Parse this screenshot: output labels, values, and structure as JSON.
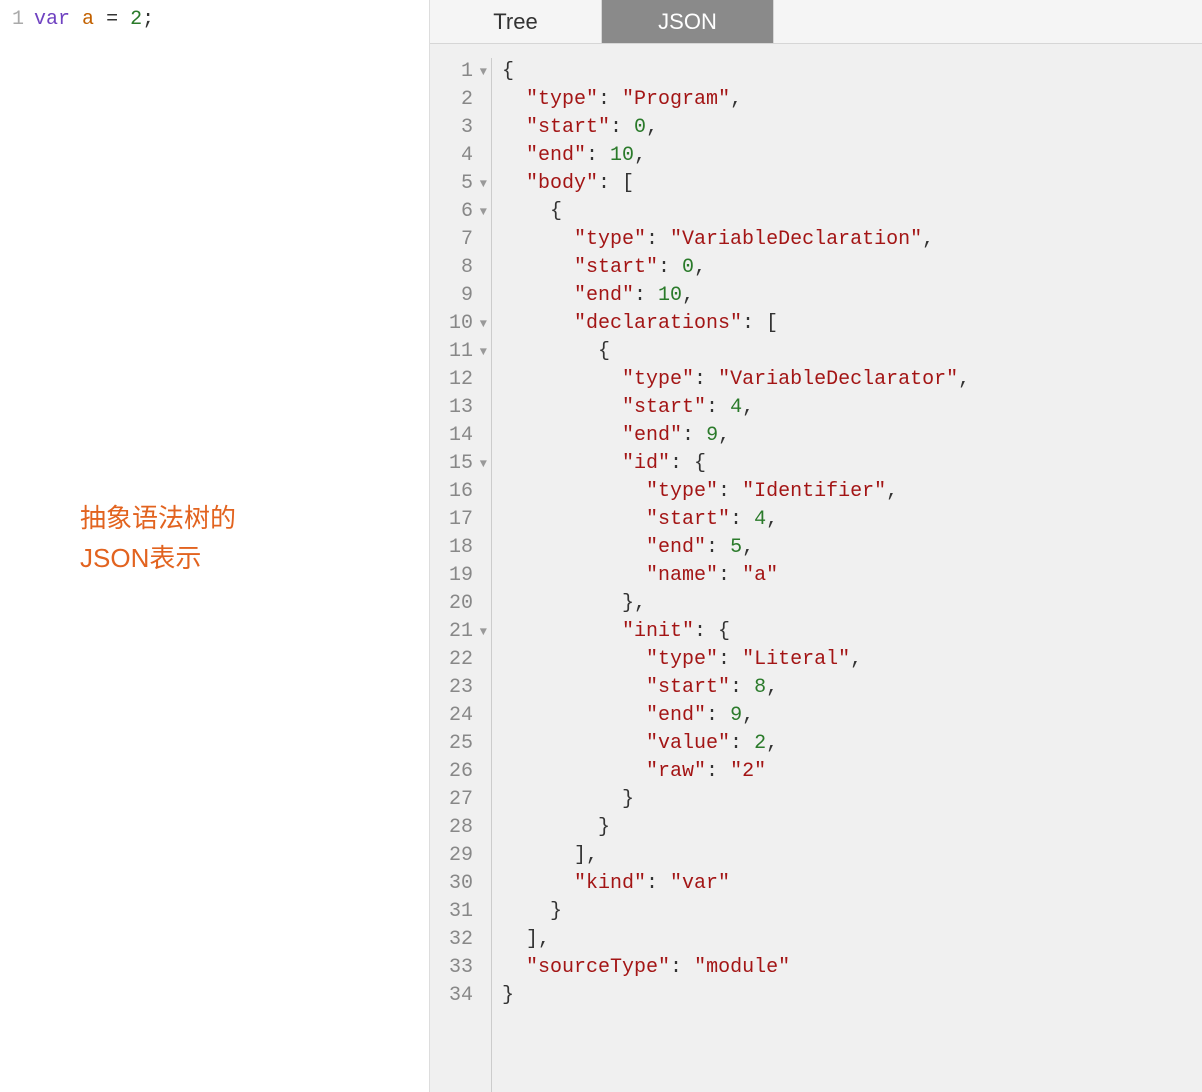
{
  "left": {
    "line_number": "1",
    "tokens": {
      "var": "var",
      "a": "a",
      "eq": "=",
      "two": "2",
      "semi": ";"
    },
    "annotation_l1": "抽象语法树的",
    "annotation_l2": "JSON表示"
  },
  "tabs": {
    "tree": "Tree",
    "json": "JSON"
  },
  "json": {
    "gutter": [
      "1",
      "2",
      "3",
      "4",
      "5",
      "6",
      "7",
      "8",
      "9",
      "10",
      "11",
      "12",
      "13",
      "14",
      "15",
      "16",
      "17",
      "18",
      "19",
      "20",
      "21",
      "22",
      "23",
      "24",
      "25",
      "26",
      "27",
      "28",
      "29",
      "30",
      "31",
      "32",
      "33",
      "34"
    ],
    "foldable": [
      1,
      5,
      6,
      10,
      11,
      15,
      21
    ],
    "lines": [
      [
        {
          "t": "p",
          "v": "{"
        }
      ],
      [
        {
          "t": "pad",
          "v": "  "
        },
        {
          "t": "k",
          "v": "\"type\""
        },
        {
          "t": "p",
          "v": ": "
        },
        {
          "t": "s",
          "v": "\"Program\""
        },
        {
          "t": "p",
          "v": ","
        }
      ],
      [
        {
          "t": "pad",
          "v": "  "
        },
        {
          "t": "k",
          "v": "\"start\""
        },
        {
          "t": "p",
          "v": ": "
        },
        {
          "t": "n",
          "v": "0"
        },
        {
          "t": "p",
          "v": ","
        }
      ],
      [
        {
          "t": "pad",
          "v": "  "
        },
        {
          "t": "k",
          "v": "\"end\""
        },
        {
          "t": "p",
          "v": ": "
        },
        {
          "t": "n",
          "v": "10"
        },
        {
          "t": "p",
          "v": ","
        }
      ],
      [
        {
          "t": "pad",
          "v": "  "
        },
        {
          "t": "k",
          "v": "\"body\""
        },
        {
          "t": "p",
          "v": ": ["
        }
      ],
      [
        {
          "t": "pad",
          "v": "    "
        },
        {
          "t": "p",
          "v": "{"
        }
      ],
      [
        {
          "t": "pad",
          "v": "      "
        },
        {
          "t": "k",
          "v": "\"type\""
        },
        {
          "t": "p",
          "v": ": "
        },
        {
          "t": "s",
          "v": "\"VariableDeclaration\""
        },
        {
          "t": "p",
          "v": ","
        }
      ],
      [
        {
          "t": "pad",
          "v": "      "
        },
        {
          "t": "k",
          "v": "\"start\""
        },
        {
          "t": "p",
          "v": ": "
        },
        {
          "t": "n",
          "v": "0"
        },
        {
          "t": "p",
          "v": ","
        }
      ],
      [
        {
          "t": "pad",
          "v": "      "
        },
        {
          "t": "k",
          "v": "\"end\""
        },
        {
          "t": "p",
          "v": ": "
        },
        {
          "t": "n",
          "v": "10"
        },
        {
          "t": "p",
          "v": ","
        }
      ],
      [
        {
          "t": "pad",
          "v": "      "
        },
        {
          "t": "k",
          "v": "\"declarations\""
        },
        {
          "t": "p",
          "v": ": ["
        }
      ],
      [
        {
          "t": "pad",
          "v": "        "
        },
        {
          "t": "p",
          "v": "{"
        }
      ],
      [
        {
          "t": "pad",
          "v": "          "
        },
        {
          "t": "k",
          "v": "\"type\""
        },
        {
          "t": "p",
          "v": ": "
        },
        {
          "t": "s",
          "v": "\"VariableDeclarator\""
        },
        {
          "t": "p",
          "v": ","
        }
      ],
      [
        {
          "t": "pad",
          "v": "          "
        },
        {
          "t": "k",
          "v": "\"start\""
        },
        {
          "t": "p",
          "v": ": "
        },
        {
          "t": "n",
          "v": "4"
        },
        {
          "t": "p",
          "v": ","
        }
      ],
      [
        {
          "t": "pad",
          "v": "          "
        },
        {
          "t": "k",
          "v": "\"end\""
        },
        {
          "t": "p",
          "v": ": "
        },
        {
          "t": "n",
          "v": "9"
        },
        {
          "t": "p",
          "v": ","
        }
      ],
      [
        {
          "t": "pad",
          "v": "          "
        },
        {
          "t": "k",
          "v": "\"id\""
        },
        {
          "t": "p",
          "v": ": {"
        }
      ],
      [
        {
          "t": "pad",
          "v": "            "
        },
        {
          "t": "k",
          "v": "\"type\""
        },
        {
          "t": "p",
          "v": ": "
        },
        {
          "t": "s",
          "v": "\"Identifier\""
        },
        {
          "t": "p",
          "v": ","
        }
      ],
      [
        {
          "t": "pad",
          "v": "            "
        },
        {
          "t": "k",
          "v": "\"start\""
        },
        {
          "t": "p",
          "v": ": "
        },
        {
          "t": "n",
          "v": "4"
        },
        {
          "t": "p",
          "v": ","
        }
      ],
      [
        {
          "t": "pad",
          "v": "            "
        },
        {
          "t": "k",
          "v": "\"end\""
        },
        {
          "t": "p",
          "v": ": "
        },
        {
          "t": "n",
          "v": "5"
        },
        {
          "t": "p",
          "v": ","
        }
      ],
      [
        {
          "t": "pad",
          "v": "            "
        },
        {
          "t": "k",
          "v": "\"name\""
        },
        {
          "t": "p",
          "v": ": "
        },
        {
          "t": "s",
          "v": "\"a\""
        }
      ],
      [
        {
          "t": "pad",
          "v": "          "
        },
        {
          "t": "p",
          "v": "},"
        }
      ],
      [
        {
          "t": "pad",
          "v": "          "
        },
        {
          "t": "k",
          "v": "\"init\""
        },
        {
          "t": "p",
          "v": ": {"
        }
      ],
      [
        {
          "t": "pad",
          "v": "            "
        },
        {
          "t": "k",
          "v": "\"type\""
        },
        {
          "t": "p",
          "v": ": "
        },
        {
          "t": "s",
          "v": "\"Literal\""
        },
        {
          "t": "p",
          "v": ","
        }
      ],
      [
        {
          "t": "pad",
          "v": "            "
        },
        {
          "t": "k",
          "v": "\"start\""
        },
        {
          "t": "p",
          "v": ": "
        },
        {
          "t": "n",
          "v": "8"
        },
        {
          "t": "p",
          "v": ","
        }
      ],
      [
        {
          "t": "pad",
          "v": "            "
        },
        {
          "t": "k",
          "v": "\"end\""
        },
        {
          "t": "p",
          "v": ": "
        },
        {
          "t": "n",
          "v": "9"
        },
        {
          "t": "p",
          "v": ","
        }
      ],
      [
        {
          "t": "pad",
          "v": "            "
        },
        {
          "t": "k",
          "v": "\"value\""
        },
        {
          "t": "p",
          "v": ": "
        },
        {
          "t": "n",
          "v": "2"
        },
        {
          "t": "p",
          "v": ","
        }
      ],
      [
        {
          "t": "pad",
          "v": "            "
        },
        {
          "t": "k",
          "v": "\"raw\""
        },
        {
          "t": "p",
          "v": ": "
        },
        {
          "t": "s",
          "v": "\"2\""
        }
      ],
      [
        {
          "t": "pad",
          "v": "          "
        },
        {
          "t": "p",
          "v": "}"
        }
      ],
      [
        {
          "t": "pad",
          "v": "        "
        },
        {
          "t": "p",
          "v": "}"
        }
      ],
      [
        {
          "t": "pad",
          "v": "      "
        },
        {
          "t": "p",
          "v": "],"
        }
      ],
      [
        {
          "t": "pad",
          "v": "      "
        },
        {
          "t": "k",
          "v": "\"kind\""
        },
        {
          "t": "p",
          "v": ": "
        },
        {
          "t": "s",
          "v": "\"var\""
        }
      ],
      [
        {
          "t": "pad",
          "v": "    "
        },
        {
          "t": "p",
          "v": "}"
        }
      ],
      [
        {
          "t": "pad",
          "v": "  "
        },
        {
          "t": "p",
          "v": "],"
        }
      ],
      [
        {
          "t": "pad",
          "v": "  "
        },
        {
          "t": "k",
          "v": "\"sourceType\""
        },
        {
          "t": "p",
          "v": ": "
        },
        {
          "t": "s",
          "v": "\"module\""
        }
      ],
      [
        {
          "t": "p",
          "v": "}"
        }
      ]
    ]
  }
}
